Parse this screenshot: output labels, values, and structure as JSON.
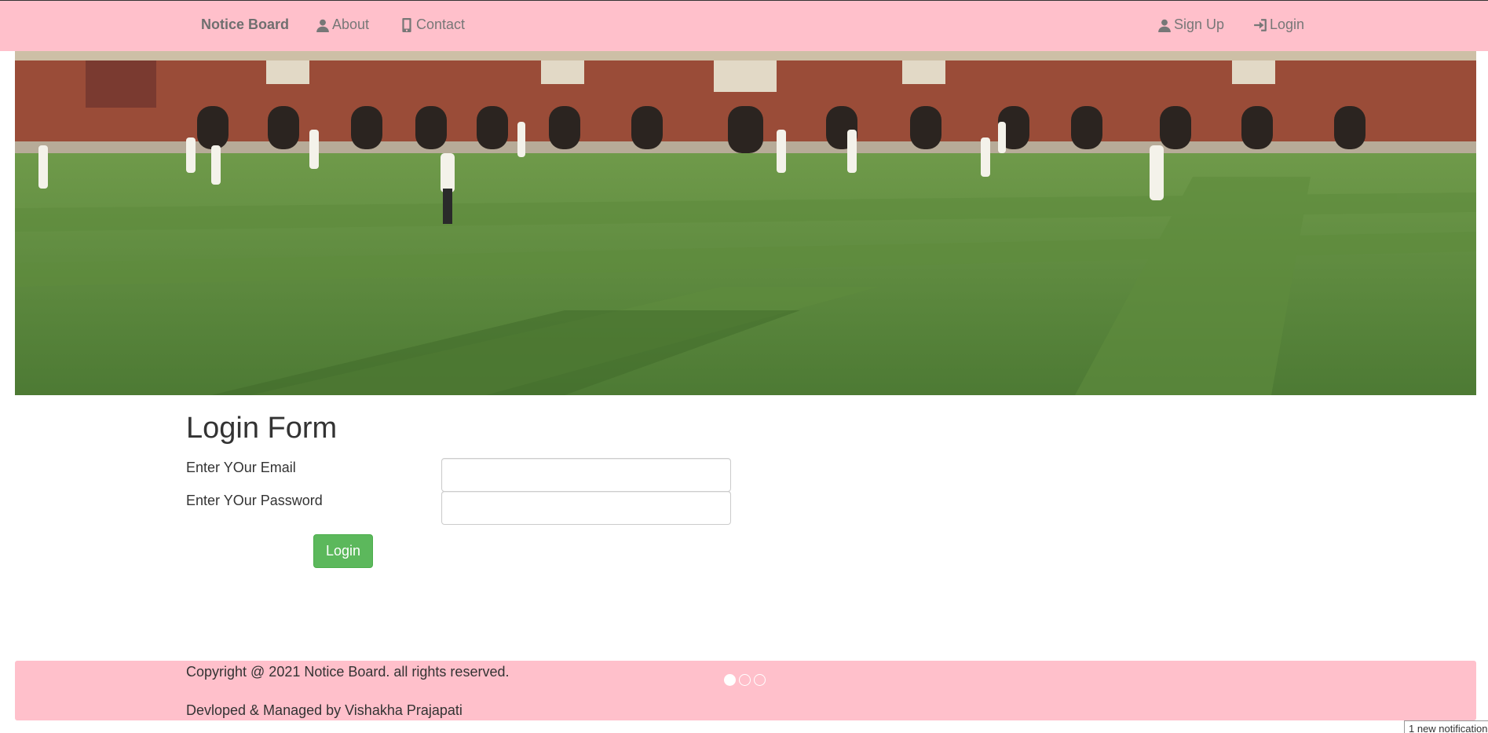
{
  "nav": {
    "brand": "Notice Board",
    "about": "About",
    "contact": "Contact",
    "signup": "Sign Up",
    "login": "Login"
  },
  "hero": {
    "icon": "cricket-field-photo"
  },
  "form": {
    "title": "Login Form",
    "email_label": "Enter YOur Email",
    "email_value": "",
    "password_label": "Enter YOur Password",
    "password_value": "",
    "submit_label": "Login"
  },
  "footer": {
    "copyright": "Copyright @ 2021 Notice Board. all rights reserved.",
    "credit": "Devloped & Managed by Vishakha Prajapati",
    "carousel_active_index": 0,
    "carousel_count": 3
  },
  "notification": "1 new notification",
  "colors": {
    "nav_bg": "#ffc0cb",
    "footer_bg": "#ffc0cb",
    "button_bg": "#5cb85c"
  }
}
